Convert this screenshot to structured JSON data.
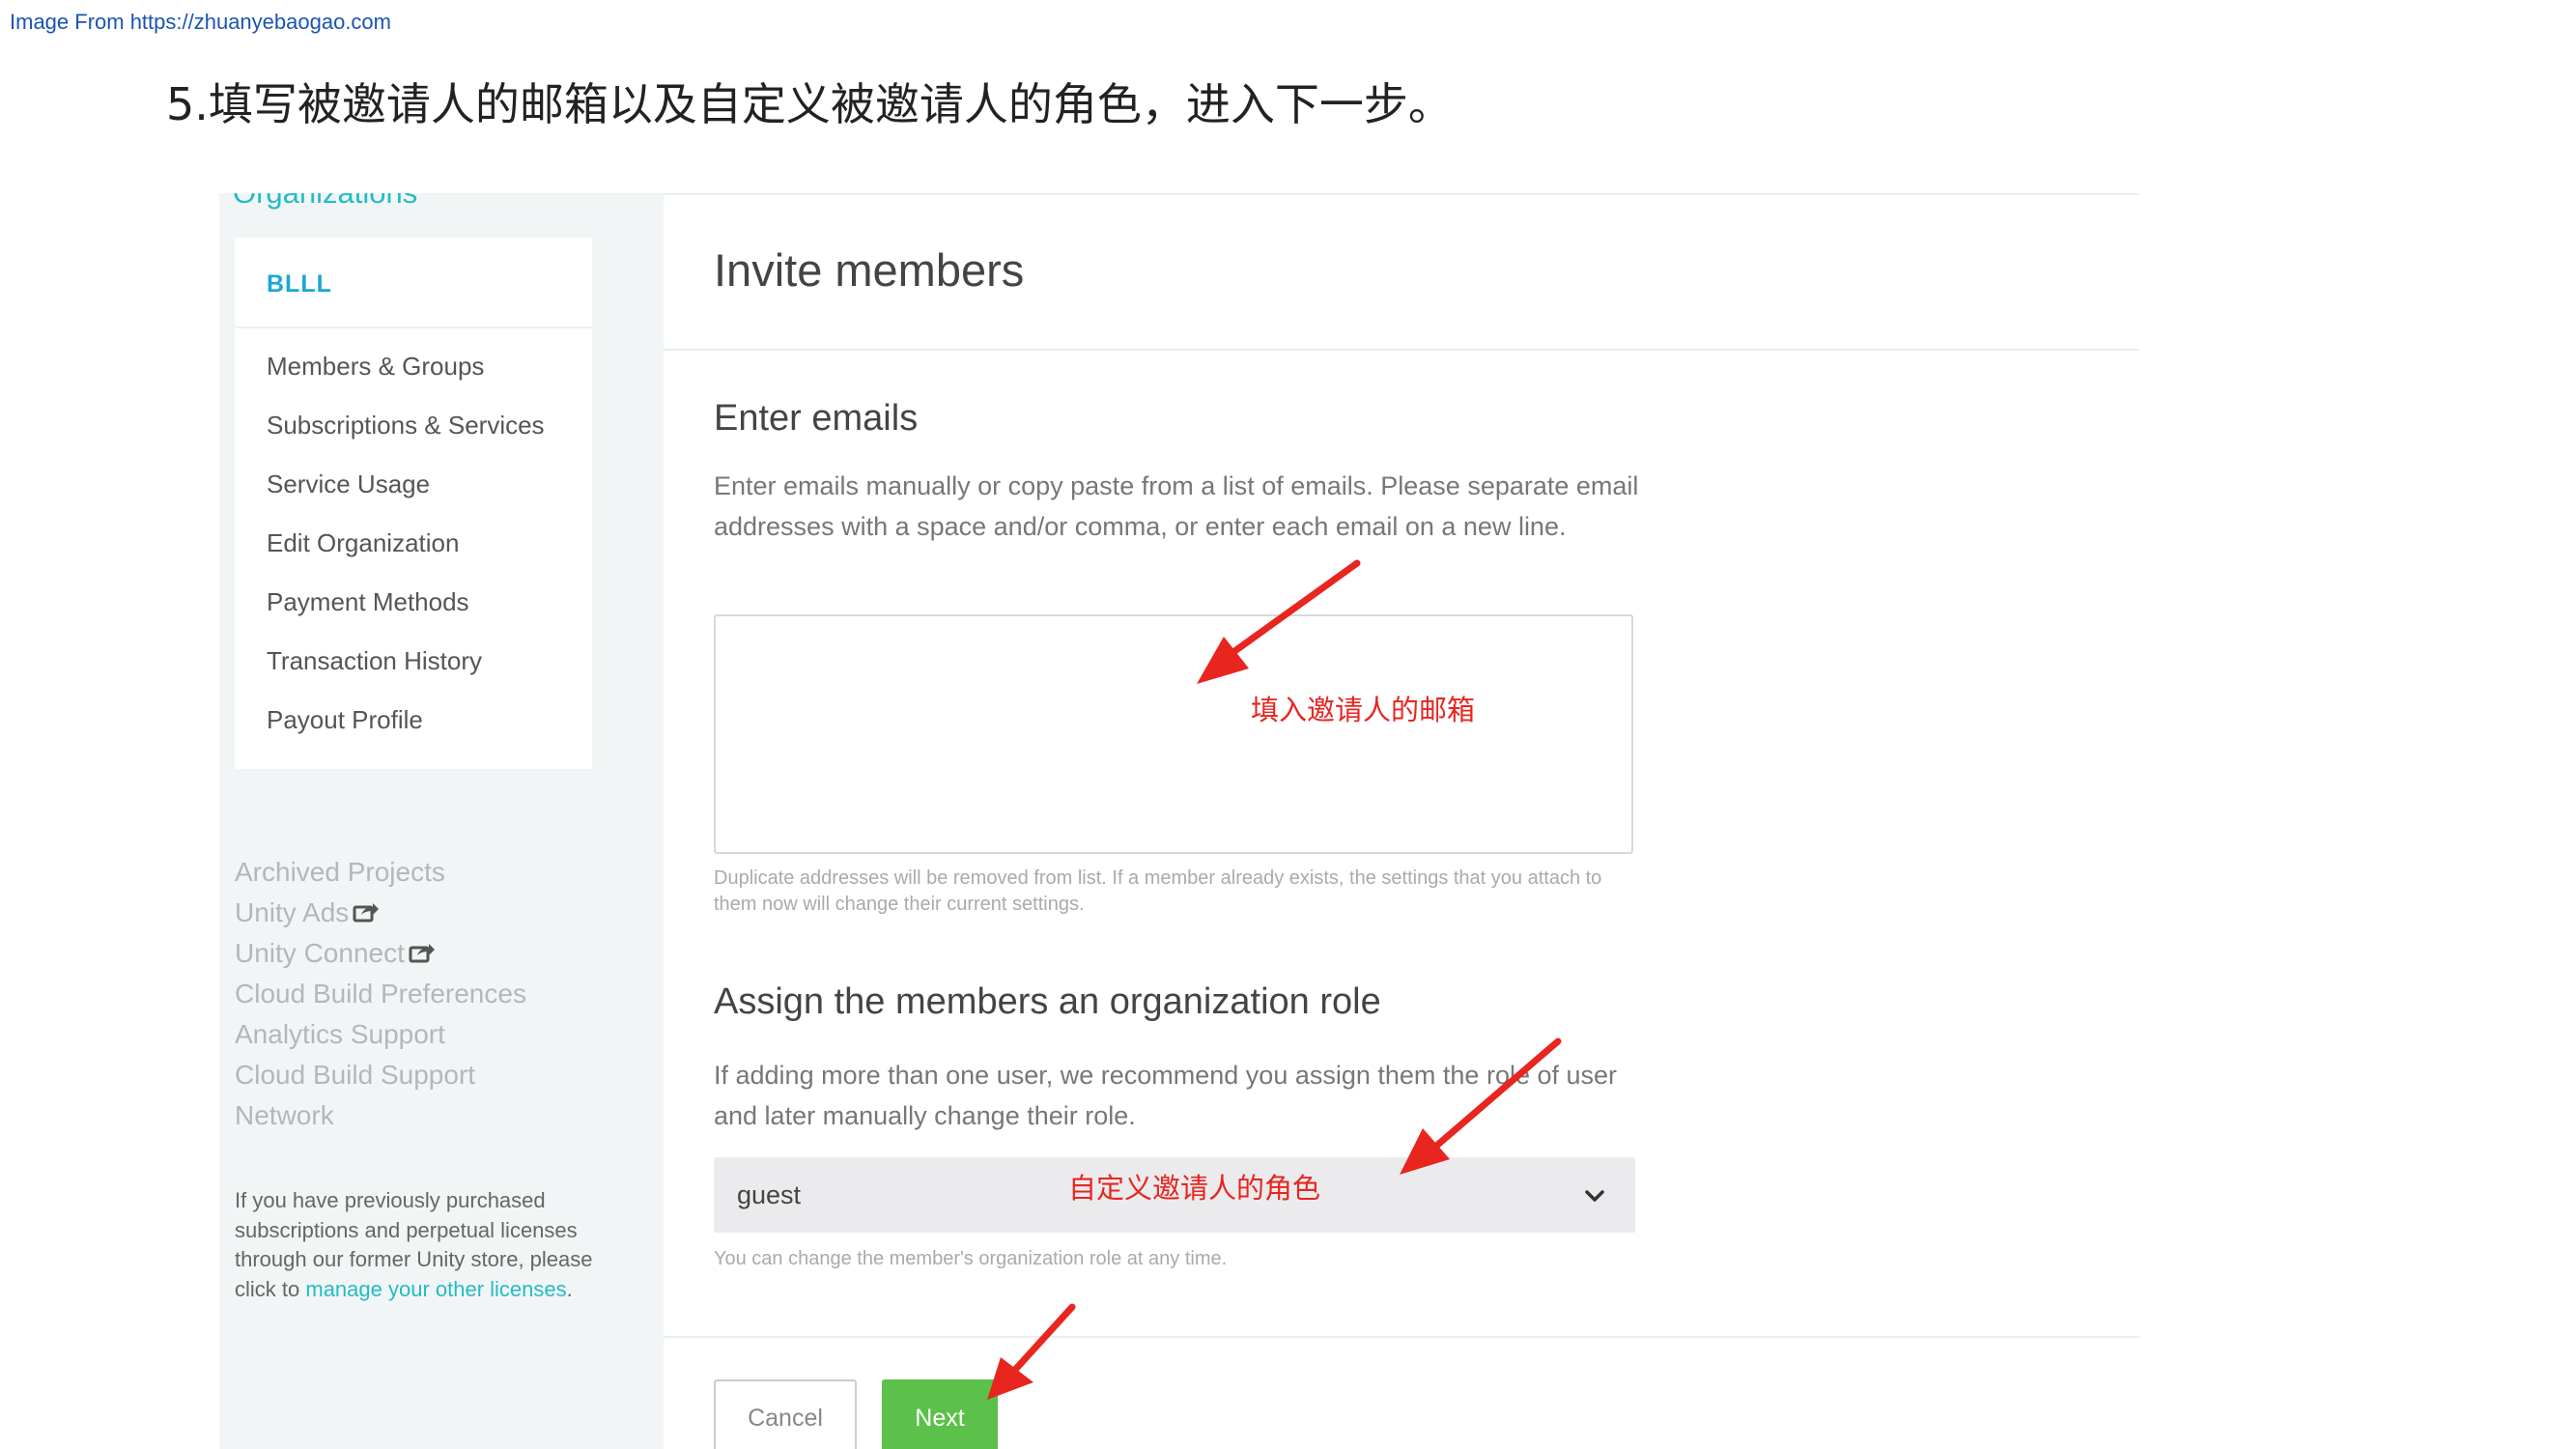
{
  "source_note": "Image From https://zhuanyebaogao.com",
  "step_heading": "5.填写被邀请人的邮箱以及自定义被邀请人的角色，进入下一步。",
  "sidebar": {
    "section_title": "Organizations",
    "org_name": "BLLL",
    "links": [
      "Members & Groups",
      "Subscriptions & Services",
      "Service Usage",
      "Edit Organization",
      "Payment Methods",
      "Transaction History",
      "Payout Profile"
    ],
    "secondary": {
      "archived_projects": "Archived Projects",
      "unity_ads": "Unity Ads",
      "unity_connect": "Unity Connect",
      "cloud_build_prefs": "Cloud Build Preferences",
      "analytics_support": "Analytics Support",
      "cloud_build_support": "Cloud Build Support",
      "network": "Network"
    },
    "note_text": "If you have previously purchased subscriptions and perpetual licenses through our former Unity store, please click to",
    "note_link": "manage your other licenses",
    "note_end": "."
  },
  "main": {
    "title": "Invite members",
    "emails_heading": "Enter emails",
    "emails_desc": "Enter emails manually or copy paste from a list of emails. Please separate email addresses with a space and/or comma, or enter each email on a new line.",
    "emails_value": "",
    "emails_note": "Duplicate addresses will be removed from list. If a member already exists, the settings that you attach to them now will change their current settings.",
    "role_heading": "Assign the members an organization role",
    "role_desc": "If adding more than one user, we recommend you assign them the role of user and later manually change their role.",
    "role_value": "guest",
    "role_note": "You can change the member's organization role at any time.",
    "cancel_label": "Cancel",
    "next_label": "Next"
  },
  "annotations": {
    "email_hint": "填入邀请人的邮箱",
    "role_hint": "自定义邀请人的角色"
  },
  "colors": {
    "accent_teal": "#22bcc7",
    "org_blue": "#1aa7d4",
    "next_green": "#5bc14a",
    "annotation_red": "#e8251f"
  }
}
